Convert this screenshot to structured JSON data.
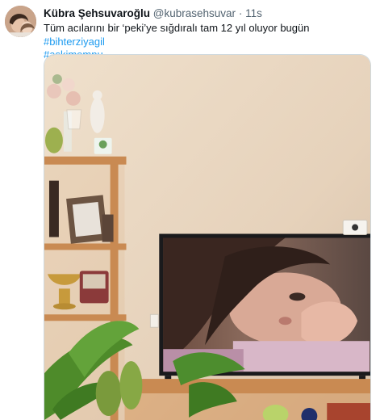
{
  "tweet": {
    "author_name": "Kübra Şehsuvaroğlu",
    "author_handle": "@kubrasehsuvar",
    "separator": "·",
    "timestamp": "11s",
    "text": "Tüm acılarını bir ‘peki’ye sığdıralı tam 12 yıl oluyor bugün ",
    "hashtags": [
      "#bihterziyagil",
      "#askimemnu"
    ]
  },
  "icons": {
    "avatar": "profile-avatar",
    "media": "photo-tv-living-room"
  },
  "colors": {
    "link": "#1d9bf0",
    "secondary_text": "#536471",
    "primary_text": "#0f1419",
    "border": "#cfd9de"
  }
}
